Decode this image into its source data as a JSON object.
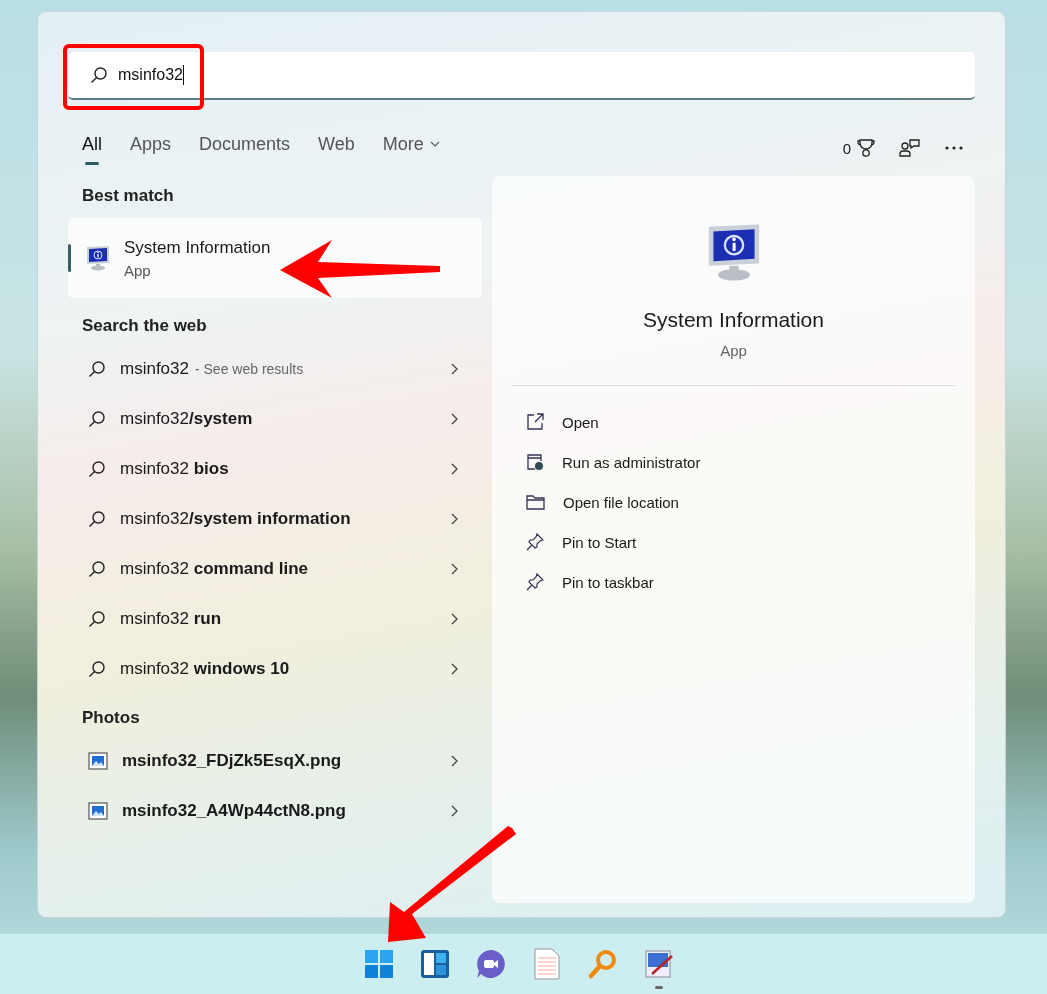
{
  "search": {
    "value": "msinfo32"
  },
  "tabs": [
    {
      "label": "All",
      "selected": true,
      "kind": "plain"
    },
    {
      "label": "Apps",
      "selected": false,
      "kind": "plain"
    },
    {
      "label": "Documents",
      "selected": false,
      "kind": "plain"
    },
    {
      "label": "Web",
      "selected": false,
      "kind": "plain"
    },
    {
      "label": "More",
      "selected": false,
      "kind": "dropdown"
    }
  ],
  "points": "0",
  "best_match": {
    "heading": "Best match",
    "title": "System Information",
    "subtitle": "App",
    "selected": true
  },
  "web": {
    "heading": "Search the web",
    "items": [
      {
        "text": "msinfo32",
        "hint": "- See web results"
      },
      {
        "text": "msinfo32**/system**"
      },
      {
        "text": "msinfo32 **bios**"
      },
      {
        "text": "msinfo32**/system information**"
      },
      {
        "text": "msinfo32 **command line**"
      },
      {
        "text": "msinfo32 **run**"
      },
      {
        "text": "msinfo32 **windows 10**"
      }
    ]
  },
  "photos": {
    "heading": "Photos",
    "items": [
      "msinfo32_FDjZk5EsqX.png",
      "msinfo32_A4Wp44ctN8.png"
    ]
  },
  "preview": {
    "title": "System Information",
    "subtitle": "App",
    "actions": [
      {
        "kind": "open",
        "label": "Open"
      },
      {
        "kind": "admin",
        "label": "Run as administrator"
      },
      {
        "kind": "folder",
        "label": "Open file location"
      },
      {
        "kind": "pin",
        "label": "Pin to Start"
      },
      {
        "kind": "pin",
        "label": "Pin to taskbar"
      }
    ]
  },
  "taskbar": [
    {
      "kind": "start",
      "running": false
    },
    {
      "kind": "widgets",
      "running": false
    },
    {
      "kind": "chat",
      "running": false
    },
    {
      "kind": "notepad",
      "running": false
    },
    {
      "kind": "magnifier",
      "running": false
    },
    {
      "kind": "paint",
      "running": true
    }
  ]
}
